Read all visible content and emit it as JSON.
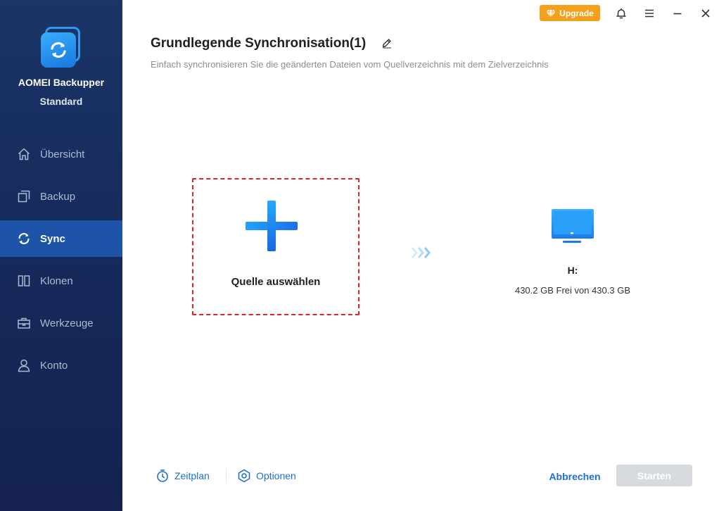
{
  "app": {
    "name": "AOMEI Backupper",
    "edition": "Standard"
  },
  "topbar": {
    "upgrade_label": "Upgrade"
  },
  "sidebar": {
    "items": [
      {
        "label": "Übersicht",
        "icon": "home-icon",
        "active": false
      },
      {
        "label": "Backup",
        "icon": "backup-icon",
        "active": false
      },
      {
        "label": "Sync",
        "icon": "sync-icon",
        "active": true
      },
      {
        "label": "Klonen",
        "icon": "clone-icon",
        "active": false
      },
      {
        "label": "Werkzeuge",
        "icon": "toolbox-icon",
        "active": false
      },
      {
        "label": "Konto",
        "icon": "user-icon",
        "active": false
      }
    ]
  },
  "header": {
    "title": "Grundlegende Synchronisation(1)",
    "subtitle": "Einfach synchronisieren Sie die geänderten Dateien vom Quellverzeichnis mit dem Zielverzeichnis"
  },
  "source": {
    "label": "Quelle auswählen"
  },
  "destination": {
    "name": "H:",
    "info": "430.2 GB Frei von 430.3 GB"
  },
  "footer": {
    "schedule_label": "Zeitplan",
    "options_label": "Optionen",
    "cancel_label": "Abbrechen",
    "start_label": "Starten"
  },
  "colors": {
    "sidebar_bg": "#1a3566",
    "sidebar_active": "#1d54a8",
    "accent": "#1b6fd6",
    "upgrade": "#f5a01c",
    "dashed_border": "#e0242f",
    "disabled_button": "#d7dade"
  }
}
